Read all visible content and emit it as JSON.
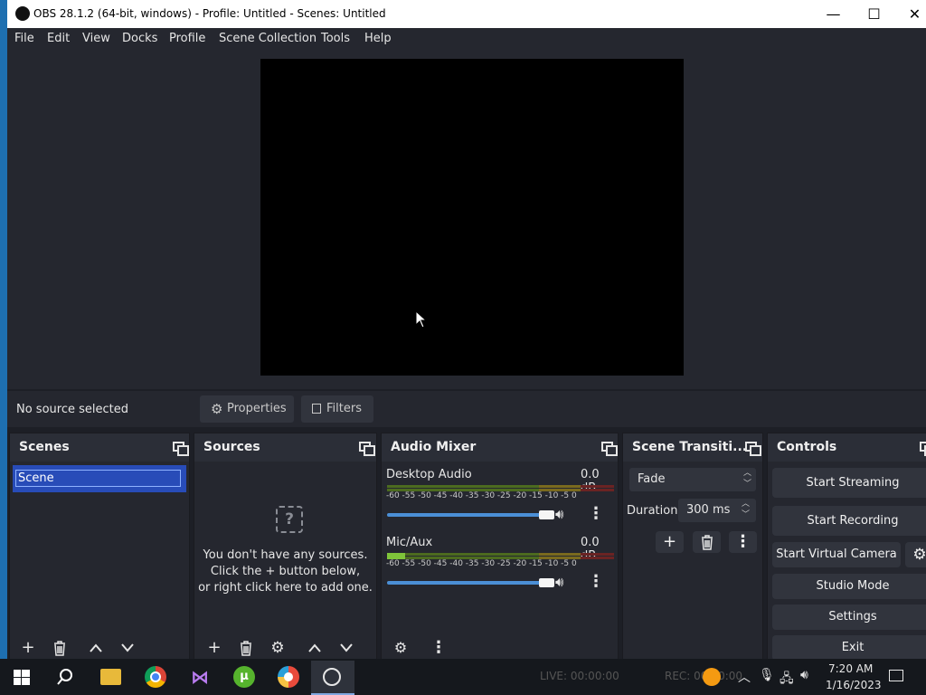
{
  "window": {
    "title": "OBS 28.1.2 (64-bit, windows) - Profile: Untitled - Scenes: Untitled",
    "minimize_glyph": "—",
    "maximize_glyph": "☐",
    "close_glyph": "✕"
  },
  "menu": {
    "items": [
      "File",
      "Edit",
      "View",
      "Docks",
      "Profile",
      "Scene Collection",
      "Tools",
      "Help"
    ]
  },
  "context_bar": {
    "status": "No source selected",
    "properties_label": "Properties",
    "filters_label": "Filters"
  },
  "scenes": {
    "title": "Scenes",
    "items": [
      "Scene"
    ]
  },
  "sources": {
    "title": "Sources",
    "empty_lines": [
      "You don't have any sources.",
      "Click the + button below,",
      "or right click here to add one."
    ]
  },
  "audio_mixer": {
    "title": "Audio Mixer",
    "ticks": "-60 -55 -50 -45 -40 -35 -30 -25 -20 -15 -10 -5  0",
    "channels": [
      {
        "name": "Desktop Audio",
        "level": "0.0 dB",
        "volume": 1.0
      },
      {
        "name": "Mic/Aux",
        "level": "0.0 dB",
        "volume": 1.0
      }
    ]
  },
  "transitions": {
    "title": "Scene Transiti...",
    "type": "Fade",
    "duration_label": "Duration",
    "duration_value": "300 ms"
  },
  "controls": {
    "title": "Controls",
    "start_streaming": "Start Streaming",
    "start_recording": "Start Recording",
    "start_virtual_camera": "Start Virtual Camera",
    "studio_mode": "Studio Mode",
    "settings": "Settings",
    "exit": "Exit"
  },
  "status_bar": {
    "live": "LIVE: 00:00:00",
    "rec": "REC: 00:00:00"
  },
  "taskbar": {
    "time": "7:20 AM",
    "date": "1/16/2023"
  },
  "colors": {
    "accent": "#4b8fd6",
    "scene_selected": "#284cb8",
    "panel": "#25272f",
    "button": "#31343d"
  }
}
